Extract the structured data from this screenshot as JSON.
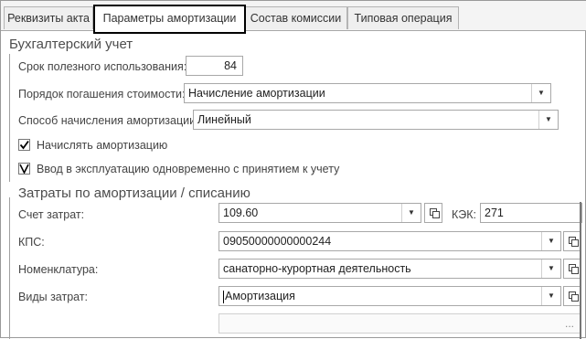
{
  "tabs": [
    {
      "label": "Реквизиты акта"
    },
    {
      "label": "Параметры амортизации"
    },
    {
      "label": "Состав комиссии"
    },
    {
      "label": "Типовая операция"
    }
  ],
  "accounting": {
    "title": "Бухгалтерский учет",
    "useful_life_label": "Срок полезного использования:",
    "useful_life_value": "84",
    "repayment_label": "Порядок погашения стоимости:",
    "repayment_value": "Начисление амортизации",
    "method_label": "Способ начисления амортизации:",
    "method_value": "Линейный",
    "accrue_label": "Начислять амортизацию",
    "commission_label": "Ввод в эксплуатацию одновременно с принятием к учету"
  },
  "costs": {
    "title": "Затраты по амортизации / списанию",
    "account_label": "Счет затрат:",
    "account_value": "109.60",
    "kek_label": "КЭК:",
    "kek_value": "271",
    "kps_label": "КПС:",
    "kps_value": "09050000000000244",
    "nomenclature_label": "Номенклатура:",
    "nomenclature_value": "санаторно-курортная деятельность",
    "cost_types_label": "Виды затрат:",
    "cost_types_value": "Амортизация",
    "extra_button": "..."
  }
}
